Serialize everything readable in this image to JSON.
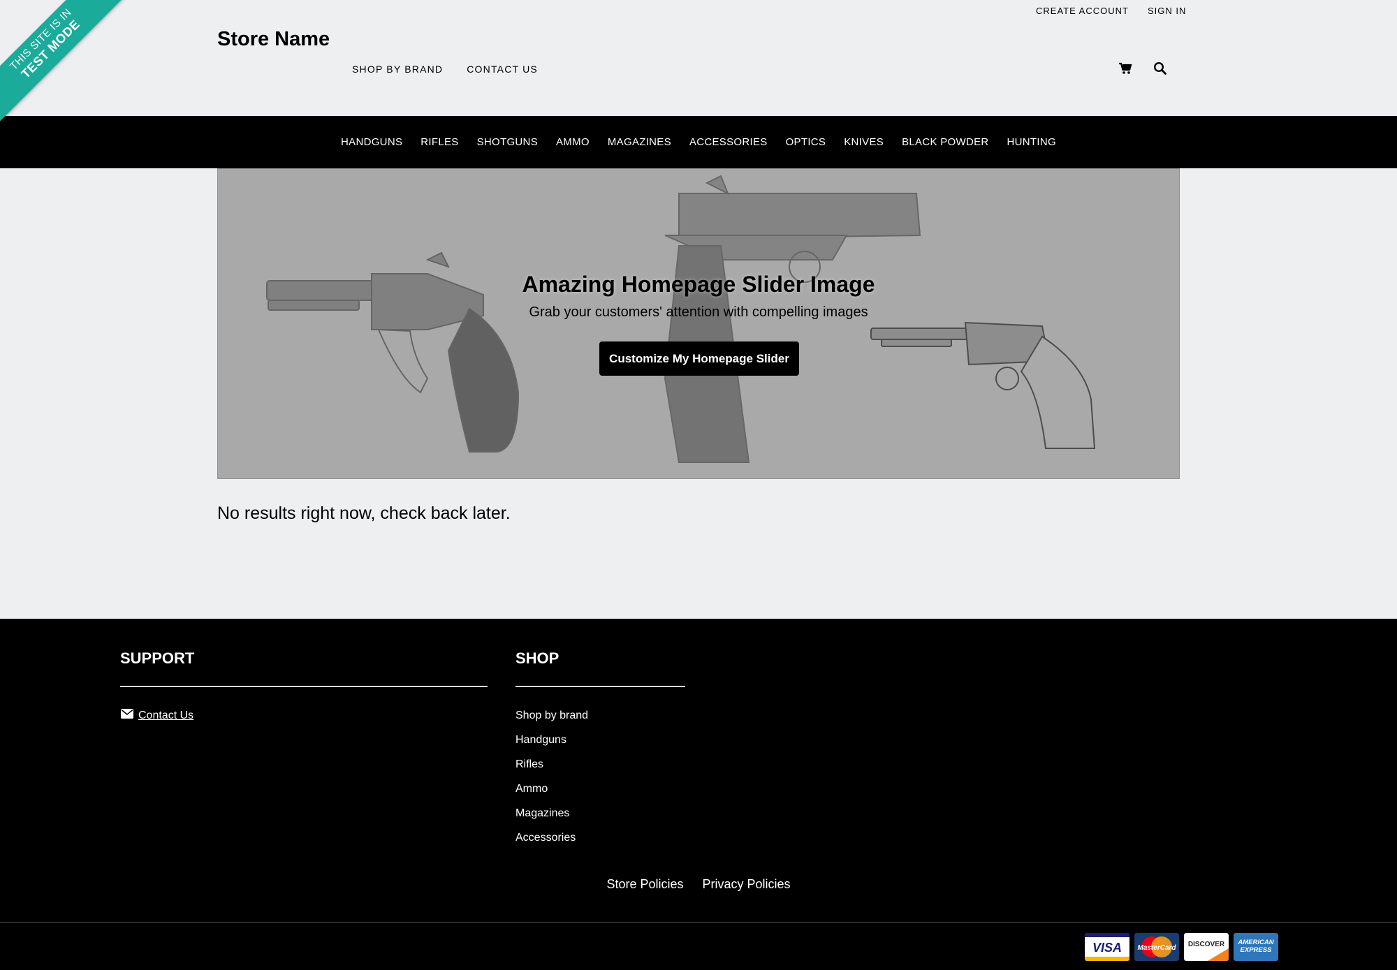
{
  "ribbon": {
    "line1": "THIS SITE IS IN",
    "line2": "TEST MODE",
    "color": "#1aab9b"
  },
  "header": {
    "store_name": "Store Name",
    "sub_nav": [
      "SHOP BY BRAND",
      "CONTACT US"
    ],
    "account_nav": [
      "CREATE ACCOUNT",
      "SIGN IN"
    ],
    "icons": [
      "cart-icon",
      "search-icon"
    ]
  },
  "main_nav": [
    "HANDGUNS",
    "RIFLES",
    "SHOTGUNS",
    "AMMO",
    "MAGAZINES",
    "ACCESSORIES",
    "OPTICS",
    "KNIVES",
    "BLACK POWDER",
    "HUNTING"
  ],
  "slider": {
    "title": "Amazing Homepage Slider Image",
    "subtitle": "Grab your customers' attention with compelling images",
    "button": "Customize My Homepage Slider"
  },
  "main": {
    "no_results": "No results right now, check back later."
  },
  "footer": {
    "support": {
      "heading": "SUPPORT",
      "contact": "Contact Us"
    },
    "shop": {
      "heading": "SHOP",
      "links": [
        "Shop by brand",
        "Handguns",
        "Rifles",
        "Ammo",
        "Magazines",
        "Accessories"
      ]
    },
    "policies": [
      "Store Policies",
      "Privacy Policies"
    ],
    "cards": [
      "VISA",
      "MasterCard",
      "DISCOVER",
      "AMERICAN EXPRESS"
    ]
  }
}
